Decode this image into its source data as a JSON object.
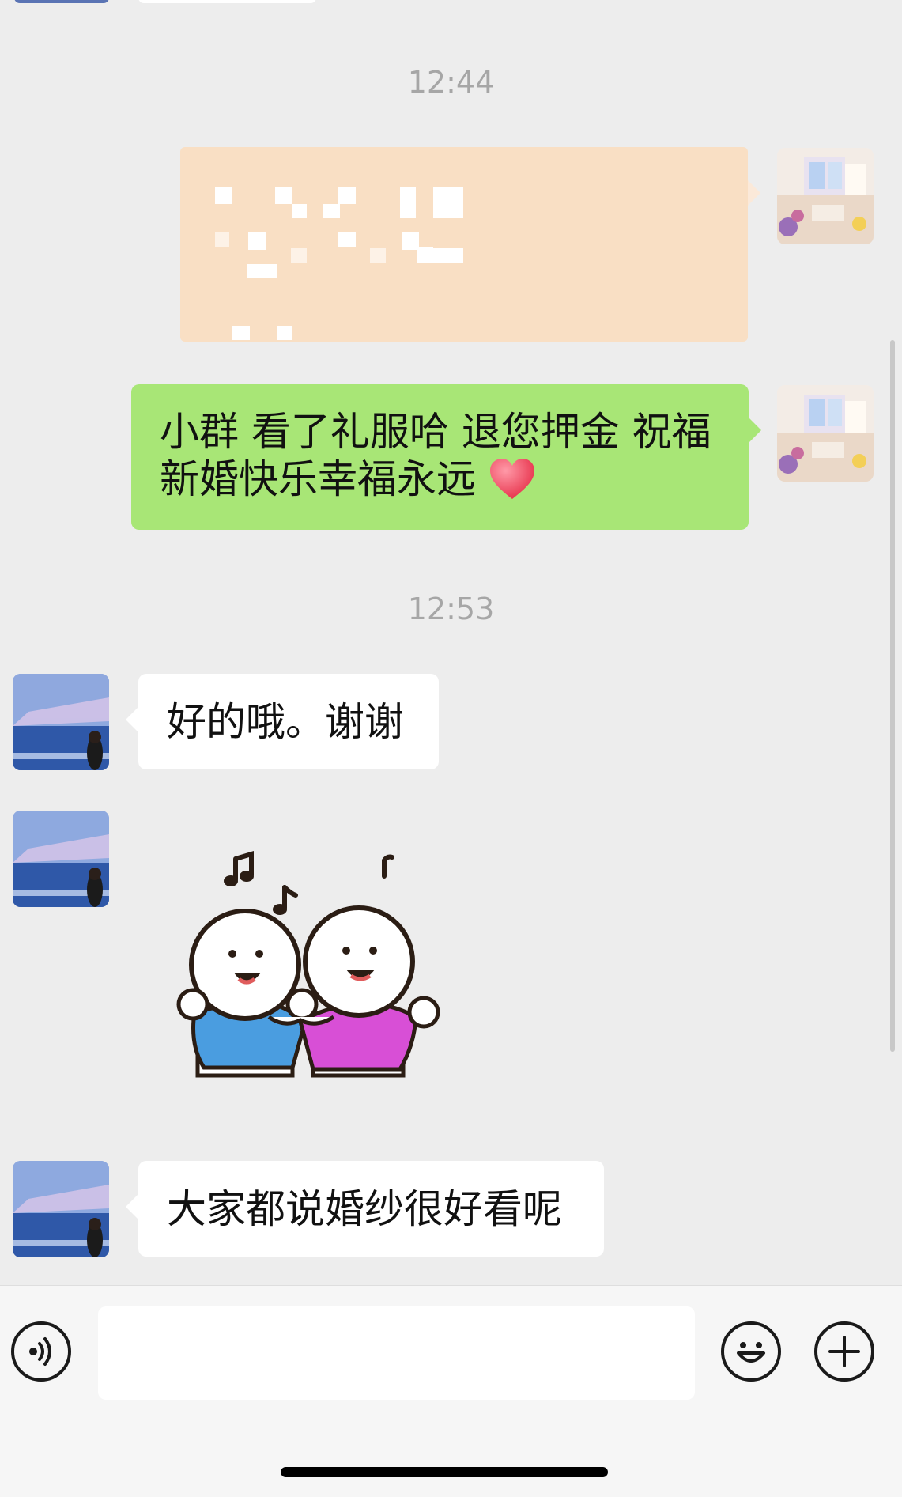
{
  "messages": {
    "time_1": "12:44",
    "msg_self_1_text": "小群 看了礼服哈 退您押金 祝福新婚快乐幸福永远",
    "time_2": "12:53",
    "msg_other_1_text": "好的哦。谢谢",
    "msg_other_3_text": "大家都说婚纱很好看呢"
  },
  "icons": {
    "voice": "voice-icon",
    "emoji": "emoji-icon",
    "plus": "plus-icon",
    "heart": "heart-emoji",
    "sticker": "dancing-friends-sticker"
  },
  "colors": {
    "self_bubble": "#a8e676",
    "other_bubble": "#ffffff",
    "background": "#ededed",
    "blurred_bubble": "#f9dfc4",
    "sticker_blue_shirt": "#4a9de0",
    "sticker_pink_shirt": "#d84fd6"
  }
}
